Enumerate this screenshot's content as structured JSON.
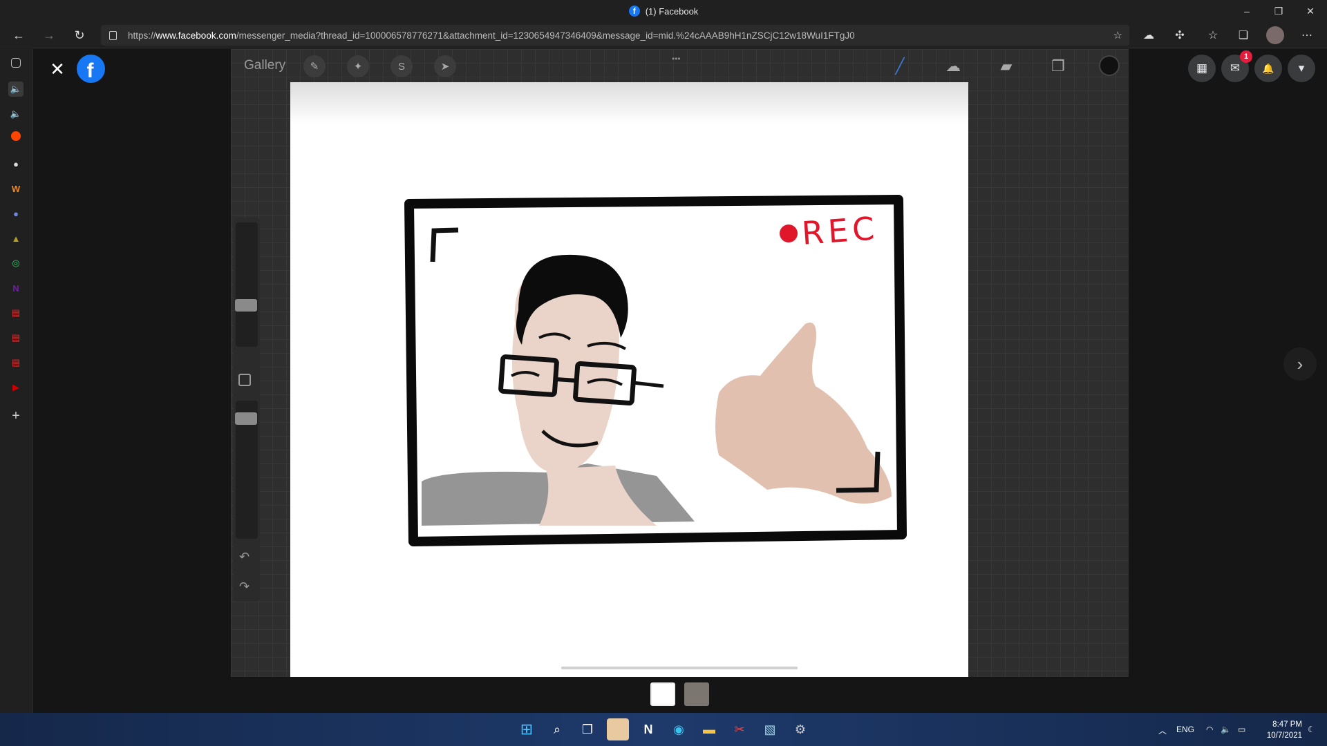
{
  "window": {
    "title": "(1) Facebook",
    "minimize": "–",
    "maximize": "❐",
    "close": "✕"
  },
  "address_bar": {
    "url_prefix": "https://",
    "url_host": "www.facebook.com",
    "url_path": "/messenger_media?thread_id=100006578776271&attachment_id=1230654947346409&message_id=mid.%24cAAAB9hH1nZSCjC12w18WuI1FTgJ0"
  },
  "nav": {
    "back": "←",
    "forward": "→",
    "reload": "↻",
    "more": "⋯"
  },
  "sidebar": {
    "icons": [
      "tabs-icon",
      "audio-icon",
      "volume-icon",
      "reddit-icon",
      "app-icon",
      "wattpad-icon",
      "discord-icon",
      "game-icon",
      "whatsapp-icon",
      "onenote-icon",
      "pdf-icon",
      "pdf-icon-2",
      "pdf-icon-3",
      "youtube-icon"
    ],
    "add": "+"
  },
  "viewer": {
    "close": "✕",
    "logo": "f",
    "next": "›"
  },
  "procreate": {
    "gallery": "Gallery",
    "drawing_text": "REC",
    "menu_dots": "•••"
  },
  "facebook_right": {
    "menu": "▦",
    "messenger": "✉",
    "notifications": "🔔",
    "account": "▾",
    "badge": "1"
  },
  "taskbar": {
    "language": "ENG",
    "time": "8:47 PM",
    "date": "10/7/2021"
  },
  "colors": {
    "facebook_blue": "#1877f2",
    "badge_red": "#e41e3f",
    "rec_red": "#e0162b"
  }
}
